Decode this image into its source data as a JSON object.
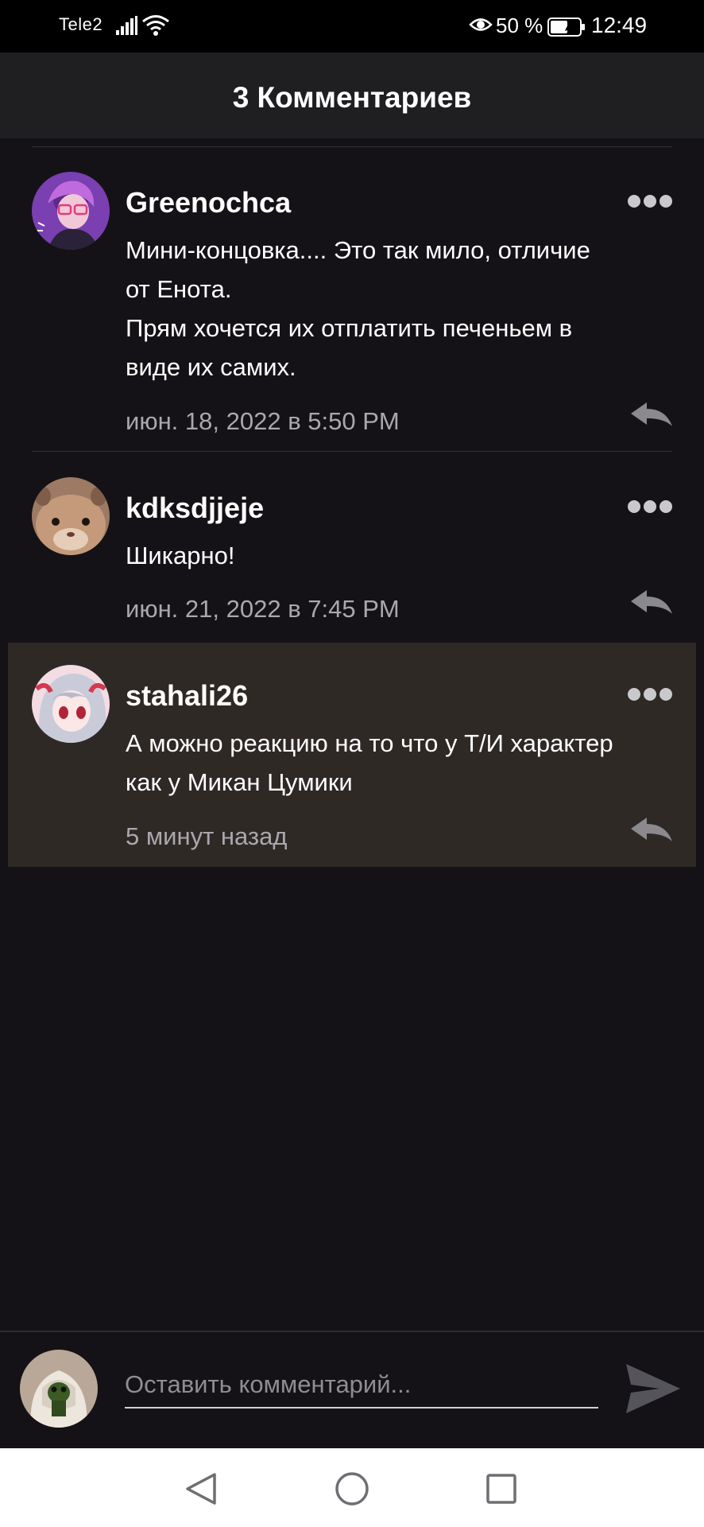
{
  "status_bar": {
    "carrier": "Tele2",
    "battery_percent": "50 %",
    "time": "12:49",
    "icons": [
      "signal-icon",
      "wifi-icon",
      "eye-comfort-icon",
      "battery-icon"
    ]
  },
  "header": {
    "title": "3 Комментариев"
  },
  "comments": [
    {
      "username": "Greenochca",
      "lines": [
        "Мини-концовка.... Это так мило, отличие",
        "от Енота.",
        "Прям хочется их отплатить печеньем в",
        "виде их самих."
      ],
      "timestamp": "июн. 18, 2022 в 5:50 PM"
    },
    {
      "username": "kdksdjjeje",
      "lines": [
        "Шикарно!"
      ],
      "timestamp": "июн. 21, 2022 в 7:45 PM"
    },
    {
      "username": "stahali26",
      "lines": [
        "А можно реакцию на то что у Т/И характер",
        "как у Микан Цумики"
      ],
      "timestamp": "5 минут назад"
    }
  ],
  "composer": {
    "placeholder": "Оставить комментарий..."
  },
  "colors": {
    "background": "#141216",
    "header": "#1f1e21",
    "highlight": "#2f2926",
    "secondary_text": "#a9a8ad"
  }
}
